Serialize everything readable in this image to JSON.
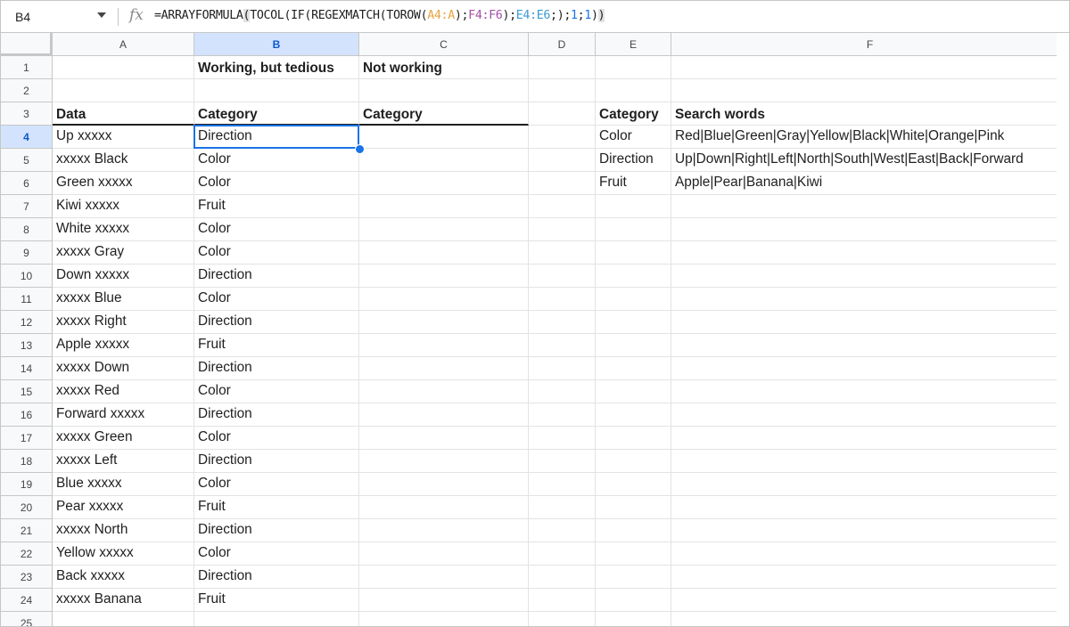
{
  "formula_bar": {
    "cell_ref": "B4",
    "fx_label": "fx",
    "formula_parts": [
      {
        "t": "=ARRAYFORMULA",
        "c": ""
      },
      {
        "t": "(",
        "c": "paren-hl"
      },
      {
        "t": "TOCOL(IF(REGEXMATCH(TOROW(",
        "c": ""
      },
      {
        "t": "A4:A",
        "c": "r1"
      },
      {
        "t": ");",
        "c": ""
      },
      {
        "t": "F4:F6",
        "c": "r2"
      },
      {
        "t": ");",
        "c": ""
      },
      {
        "t": "E4:E6",
        "c": "r3"
      },
      {
        "t": ";);",
        "c": ""
      },
      {
        "t": "1",
        "c": "num"
      },
      {
        "t": ";",
        "c": ""
      },
      {
        "t": "1",
        "c": "num"
      },
      {
        "t": ")",
        "c": ""
      },
      {
        "t": ")",
        "c": "paren-hl"
      }
    ]
  },
  "columns": [
    "A",
    "B",
    "C",
    "D",
    "E",
    "F"
  ],
  "selected_column": "B",
  "selected_row": "4",
  "row_numbers": [
    "1",
    "2",
    "3",
    "4",
    "5",
    "6",
    "7",
    "8",
    "9",
    "10",
    "11",
    "12",
    "13",
    "14",
    "15",
    "16",
    "17",
    "18",
    "19",
    "20",
    "21",
    "22",
    "23",
    "24",
    "25"
  ],
  "cells": {
    "B1": "Working, but tedious",
    "C1": "Not working",
    "A3": "Data",
    "B3": "Category",
    "C3": "Category",
    "E3": "Category",
    "F3": "Search words",
    "E4": "Color",
    "F4": "Red|Blue|Green|Gray|Yellow|Black|White|Orange|Pink",
    "E5": "Direction",
    "F5": "Up|Down|Right|Left|North|South|West|East|Back|Forward",
    "E6": "Fruit",
    "F6": "Apple|Pear|Banana|Kiwi"
  },
  "data_rows": [
    {
      "row": "4",
      "data": "Up xxxxx",
      "category": "Direction"
    },
    {
      "row": "5",
      "data": "xxxxx Black",
      "category": "Color"
    },
    {
      "row": "6",
      "data": "Green xxxxx",
      "category": "Color"
    },
    {
      "row": "7",
      "data": "Kiwi xxxxx",
      "category": "Fruit"
    },
    {
      "row": "8",
      "data": "White xxxxx",
      "category": "Color"
    },
    {
      "row": "9",
      "data": "xxxxx Gray",
      "category": "Color"
    },
    {
      "row": "10",
      "data": "Down xxxxx",
      "category": "Direction"
    },
    {
      "row": "11",
      "data": "xxxxx Blue",
      "category": "Color"
    },
    {
      "row": "12",
      "data": "xxxxx Right",
      "category": "Direction"
    },
    {
      "row": "13",
      "data": "Apple xxxxx",
      "category": "Fruit"
    },
    {
      "row": "14",
      "data": "xxxxx Down",
      "category": "Direction"
    },
    {
      "row": "15",
      "data": "xxxxx Red",
      "category": "Color"
    },
    {
      "row": "16",
      "data": "Forward xxxxx",
      "category": "Direction"
    },
    {
      "row": "17",
      "data": "xxxxx Green",
      "category": "Color"
    },
    {
      "row": "18",
      "data": "xxxxx Left",
      "category": "Direction"
    },
    {
      "row": "19",
      "data": "Blue xxxxx",
      "category": "Color"
    },
    {
      "row": "20",
      "data": "Pear xxxxx",
      "category": "Fruit"
    },
    {
      "row": "21",
      "data": "xxxxx North",
      "category": "Direction"
    },
    {
      "row": "22",
      "data": "Yellow xxxxx",
      "category": "Color"
    },
    {
      "row": "23",
      "data": "Back xxxxx",
      "category": "Direction"
    },
    {
      "row": "24",
      "data": "xxxxx Banana",
      "category": "Fruit"
    }
  ],
  "colors": {
    "selection": "#1a73e8",
    "header_selected_bg": "#d3e3fd",
    "range_A": "#e8a33d",
    "range_F": "#a64ea8",
    "range_E": "#3c9ad6"
  }
}
